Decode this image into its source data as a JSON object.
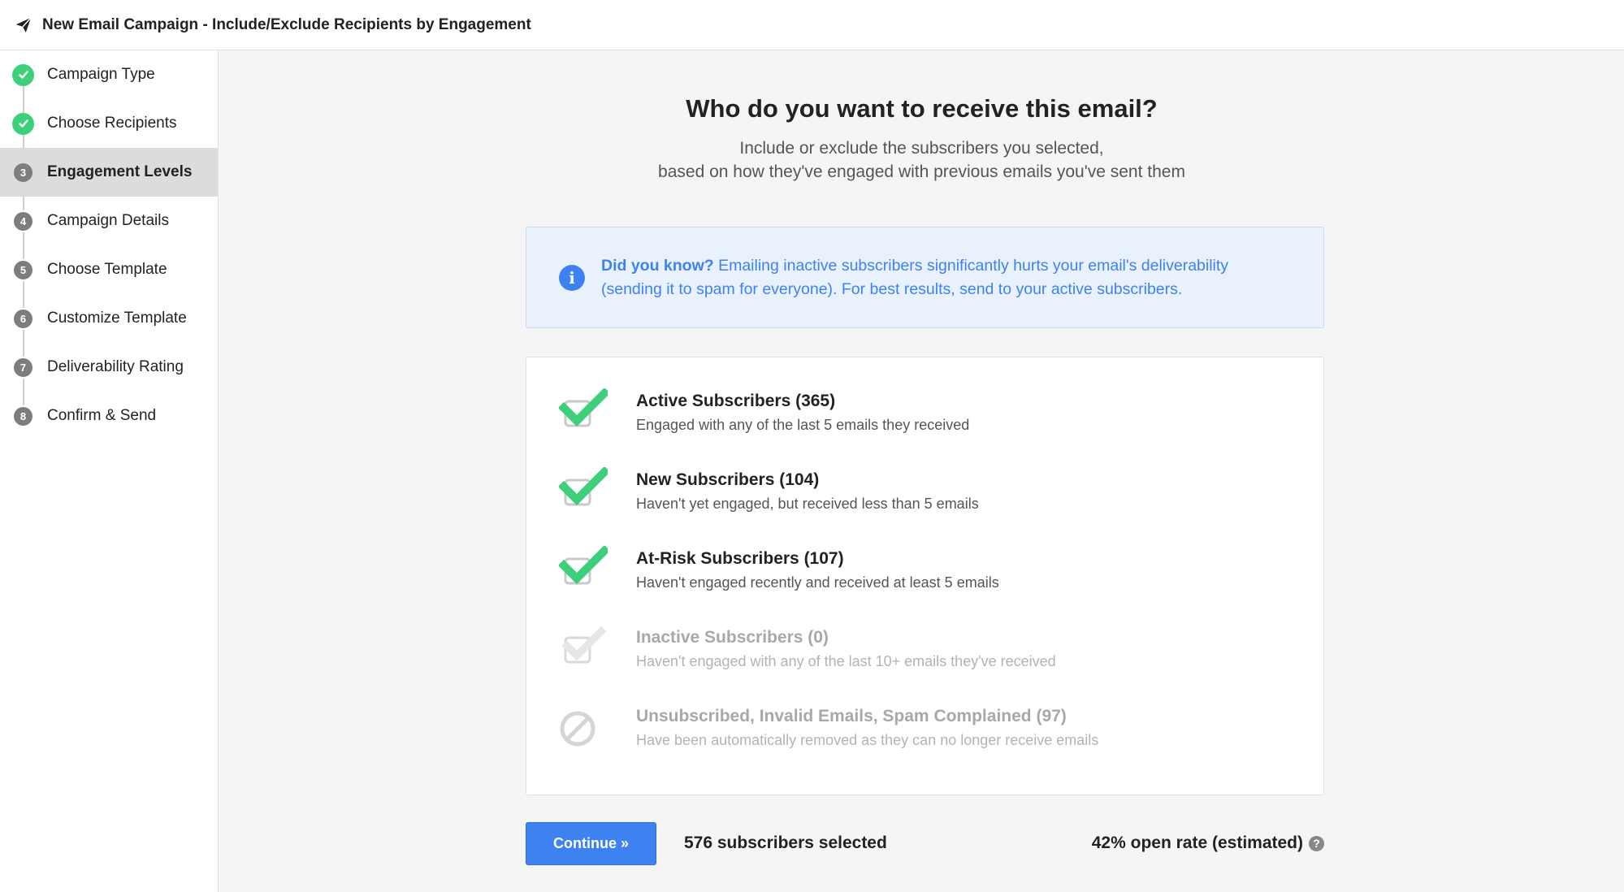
{
  "header": {
    "title": "New Email Campaign - Include/Exclude Recipients by Engagement"
  },
  "sidebar": {
    "steps": [
      {
        "label": "Campaign Type",
        "number": "1",
        "state": "done"
      },
      {
        "label": "Choose Recipients",
        "number": "2",
        "state": "done"
      },
      {
        "label": "Engagement Levels",
        "number": "3",
        "state": "active"
      },
      {
        "label": "Campaign Details",
        "number": "4",
        "state": "pending"
      },
      {
        "label": "Choose Template",
        "number": "5",
        "state": "pending"
      },
      {
        "label": "Customize Template",
        "number": "6",
        "state": "pending"
      },
      {
        "label": "Deliverability Rating",
        "number": "7",
        "state": "pending"
      },
      {
        "label": "Confirm & Send",
        "number": "8",
        "state": "pending"
      }
    ]
  },
  "main": {
    "heading": "Who do you want to receive this email?",
    "subtitle_line1": "Include or exclude the subscribers you selected,",
    "subtitle_line2": "based on how they've engaged with previous emails you've sent them",
    "info": {
      "lead": "Did you know?",
      "line1": " Emailing inactive subscribers significantly hurts your email's deliverability",
      "line2": "(sending it to spam for everyone). For best results, send to your active subscribers."
    },
    "options": [
      {
        "title": "Active Subscribers (365)",
        "desc": "Engaged with any of the last 5 emails they received",
        "state": "checked"
      },
      {
        "title": "New Subscribers (104)",
        "desc": "Haven't yet engaged, but received less than 5 emails",
        "state": "checked"
      },
      {
        "title": "At-Risk Subscribers (107)",
        "desc": "Haven't engaged recently and received at least 5 emails",
        "state": "checked"
      },
      {
        "title": "Inactive Subscribers (0)",
        "desc": "Haven't engaged with any of the last 10+ emails they've received",
        "state": "disabled"
      },
      {
        "title": "Unsubscribed, Invalid Emails, Spam Complained (97)",
        "desc": "Have been automatically removed as they can no longer receive emails",
        "state": "blocked"
      }
    ],
    "footer": {
      "continue_label": "Continue »",
      "selected_text": "576 subscribers selected",
      "open_rate_text": "42% open rate (estimated)"
    }
  },
  "colors": {
    "accent": "#3d82f0",
    "success": "#3ecf7b",
    "info_bg": "#e9f1fd"
  }
}
